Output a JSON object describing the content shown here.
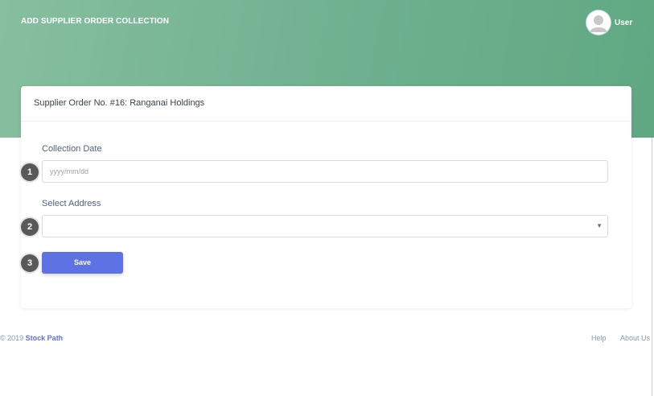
{
  "header": {
    "page_title": "ADD SUPPLIER ORDER COLLECTION",
    "user_label": "User"
  },
  "card": {
    "title": "Supplier Order No. #16: Ranganai Holdings",
    "collection_date": {
      "label": "Collection Date",
      "placeholder": "yyyy/mm/dd",
      "value": ""
    },
    "address": {
      "label": "Select Address",
      "selected": ""
    },
    "save_label": "Save"
  },
  "steps": [
    "1",
    "2",
    "3"
  ],
  "footer": {
    "copyright": "© 2019",
    "brand": "Stock Path",
    "links": [
      "Help",
      "About Us"
    ]
  },
  "colors": {
    "header_gradient_start": "#86bf9f",
    "header_gradient_end": "#5fa882",
    "primary_button": "#5e72e4",
    "step_badge": "#595959"
  },
  "icons": {
    "avatar": "user-avatar-icon",
    "select_caret": "caret-down-icon"
  }
}
